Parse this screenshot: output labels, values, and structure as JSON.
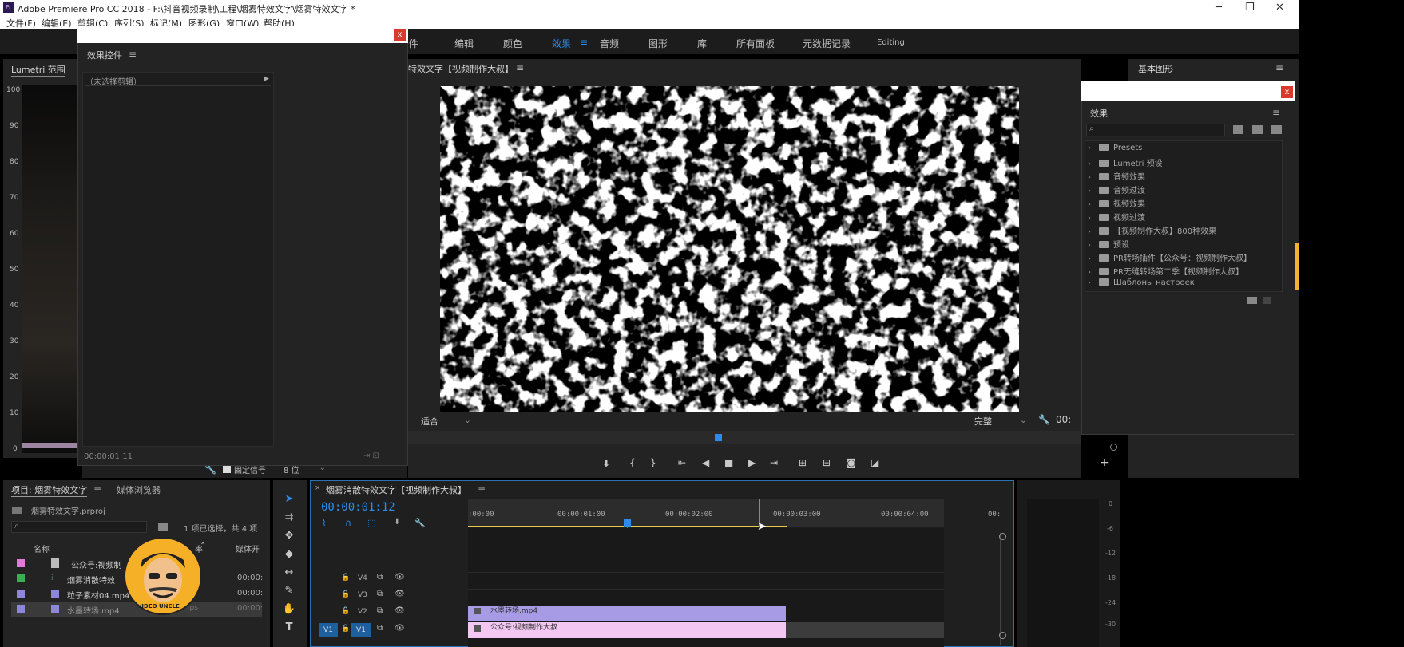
{
  "window": {
    "title": "Adobe Premiere Pro CC 2018 - F:\\抖音视频录制\\工程\\烟雾特效文字\\烟雾特效文字 *",
    "app_icon": "Pr",
    "menus": [
      "文件(F)",
      "编辑(E)",
      "剪辑(C)",
      "序列(S)",
      "标记(M)",
      "图形(G)",
      "窗口(W)",
      "帮助(H)"
    ],
    "controls": {
      "minimize": "─",
      "restore": "❐",
      "close": "✕"
    }
  },
  "workspaces": {
    "items": [
      "件",
      "编辑",
      "颜色",
      "效果",
      "音频",
      "图形",
      "库",
      "所有面板",
      "元数据记录",
      "Editing"
    ],
    "active": "效果",
    "menu_icon": "≡"
  },
  "lumetri": {
    "tab": "Lumetri 范围",
    "scale": [
      "100",
      "90",
      "80",
      "70",
      "60",
      "50",
      "40",
      "30",
      "20",
      "10",
      "0"
    ]
  },
  "effect_controls": {
    "title": "效果控件",
    "no_clip": "（未选择剪辑）",
    "timecode": "00:00:01:11",
    "close": "x"
  },
  "source_bottom": {
    "pin_label": "固定信号",
    "bit_depth": "8 位"
  },
  "program": {
    "title": "特效文字【视频制作大叔】",
    "fit": "适合",
    "quality": "完整",
    "timecode": "00:"
  },
  "essential_graphics": {
    "title": "基本图形"
  },
  "effects_panel": {
    "title": "效果",
    "search_placeholder": "",
    "close": "x",
    "folders": [
      "Presets",
      "Lumetri 预设",
      "音频效果",
      "音频过渡",
      "视频效果",
      "视频过渡",
      "【视频制作大叔】800种效果",
      "预设",
      "PR转场插件【公众号：视频制作大叔】",
      "PR无缝转场第二季【视频制作大叔】",
      "Шаблоны настроек"
    ]
  },
  "project": {
    "tab": "项目: 烟雾特效文字",
    "media_browser": "媒体浏览器",
    "file": "烟雾特效文字.prproj",
    "selection": "1 项已选择，共 4 项",
    "col_name": "名称",
    "col_rate": "率",
    "col_media": "媒体开",
    "items": [
      {
        "name": "公众号:视频制",
        "color": "#e07ad6",
        "time": ""
      },
      {
        "name": "烟雾消散特效",
        "color": "#3cae52",
        "time": "00:00:"
      },
      {
        "name": "粒子素材04.mp4",
        "color": "#8e86d8",
        "time": "00:00:"
      },
      {
        "name": "水墨转场.mp4",
        "color": "#8e86d8",
        "time": "00:00:",
        "rate": "25 fps"
      }
    ],
    "watermark": "VIDEO UNCLE"
  },
  "timeline": {
    "title": "烟雾消散特效文字【视频制作大叔】",
    "timecode": "00:00:01:12",
    "ruler": [
      ":00:00",
      "00:00:01:00",
      "00:00:02:00",
      "00:00:03:00",
      "00:00:04:00",
      "00:"
    ],
    "tracks": [
      "V4",
      "V3",
      "V2",
      "V1"
    ],
    "target": "V1",
    "clips": [
      {
        "name": "水墨转场.mp4",
        "track": "V2"
      },
      {
        "name": "公众号:视频制作大叔",
        "track": "V1"
      }
    ]
  },
  "audio_meter": {
    "scale": [
      "0",
      "-6",
      "-12",
      "-18",
      "-24",
      "-30"
    ]
  },
  "colors": {
    "accent_blue": "#2d8ceb",
    "panel_bg": "#232323",
    "clip_purple": "#a79be6",
    "clip_pink": "#f2c7f2",
    "close_red": "#d83b2b"
  }
}
